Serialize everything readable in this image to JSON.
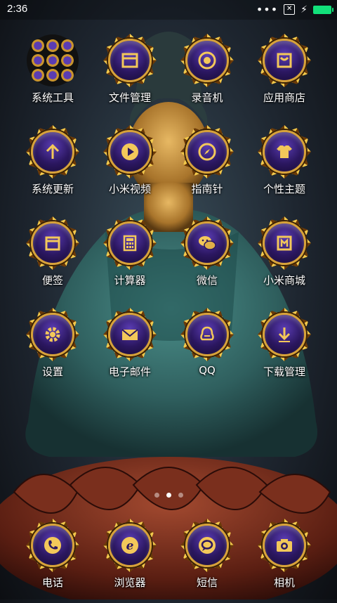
{
  "status_bar": {
    "time": "2:36",
    "icons": [
      "more-dots-icon",
      "notification-x-icon",
      "charging-icon",
      "battery-icon"
    ],
    "battery_color": "#12e07a"
  },
  "apps_grid": [
    {
      "label": "系统工具",
      "icon": "folder-icon"
    },
    {
      "label": "文件管理",
      "icon": "file-manager-icon"
    },
    {
      "label": "录音机",
      "icon": "record-icon"
    },
    {
      "label": "应用商店",
      "icon": "app-store-icon"
    },
    {
      "label": "系统更新",
      "icon": "update-arrow-icon"
    },
    {
      "label": "小米视频",
      "icon": "play-icon"
    },
    {
      "label": "指南针",
      "icon": "compass-icon"
    },
    {
      "label": "个性主题",
      "icon": "tshirt-icon"
    },
    {
      "label": "便签",
      "icon": "note-icon"
    },
    {
      "label": "计算器",
      "icon": "calculator-icon"
    },
    {
      "label": "微信",
      "icon": "wechat-icon"
    },
    {
      "label": "小米商城",
      "icon": "mi-store-icon"
    },
    {
      "label": "设置",
      "icon": "gear-icon"
    },
    {
      "label": "电子邮件",
      "icon": "mail-icon"
    },
    {
      "label": "QQ",
      "icon": "qq-penguin-icon"
    },
    {
      "label": "下载管理",
      "icon": "download-icon"
    }
  ],
  "page_indicator": {
    "pages": 3,
    "current": 1
  },
  "dock": [
    {
      "label": "电话",
      "icon": "phone-icon"
    },
    {
      "label": "浏览器",
      "icon": "browser-e-icon"
    },
    {
      "label": "短信",
      "icon": "message-bubble-icon"
    },
    {
      "label": "相机",
      "icon": "camera-icon"
    }
  ],
  "theme": {
    "accent_gold": "#d7a23a",
    "icon_purple": "#2b1760"
  }
}
